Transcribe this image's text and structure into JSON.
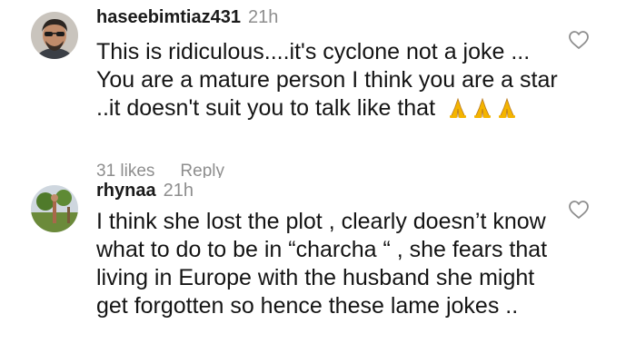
{
  "comments": [
    {
      "username": "haseebimtiaz431",
      "time": "21h",
      "text": "This is ridiculous....it's cyclone not a joke ... You are a mature person I think you are a star ..it doesn't suit you to talk like that",
      "emoji": "🙏🙏🙏",
      "likes": "31 likes",
      "reply": "Reply"
    },
    {
      "username": "rhynaa",
      "time": "21h",
      "text": "I think she lost the plot , clearly doesn’t know what to do to be in “charcha “ , she fears that living in Europe with the husband she might get forgotten so hence these lame jokes .."
    }
  ],
  "icons": {
    "like": "heart-outline-icon",
    "emoji": "folded-hands-icon"
  },
  "colors": {
    "username": "#1a1a1a",
    "text": "#141414",
    "muted": "#8e8e8e",
    "emoji": "#f4b400"
  }
}
